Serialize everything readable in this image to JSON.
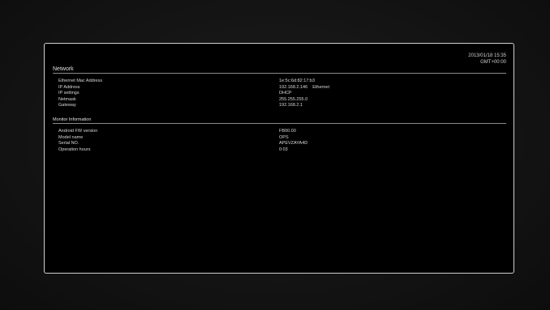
{
  "clock": {
    "datetime": "2013/01/18 15:35",
    "timezone": "GMT+00:00"
  },
  "network": {
    "title": "Network",
    "rows": [
      {
        "label": "Ethernet Mac Address",
        "value": "1e:5c:6d:82:17:b3",
        "extra": ""
      },
      {
        "label": "IP Address",
        "value": "192.168.2.146",
        "extra": "Ethernet"
      },
      {
        "label": "IP settings",
        "value": "DHCP",
        "extra": ""
      },
      {
        "label": "Netmask",
        "value": "255.255.255.0",
        "extra": ""
      },
      {
        "label": "Gateway",
        "value": "192.168.2.1",
        "extra": ""
      }
    ]
  },
  "monitor": {
    "title": "Monitor Information",
    "rows": [
      {
        "label": "Android FW version",
        "value": "FB00.00"
      },
      {
        "label": "Model name",
        "value": "OPS"
      },
      {
        "label": "Serial NO.",
        "value": "APEVZAYA4D"
      },
      {
        "label": "Operation hours",
        "value": "0:03"
      }
    ]
  }
}
